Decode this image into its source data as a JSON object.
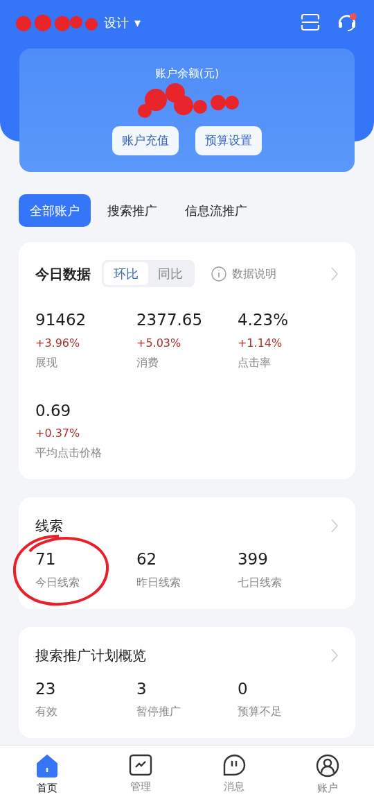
{
  "header": {
    "account_name": "设计",
    "dropdown_caret": "▾",
    "has_notification": true
  },
  "balance_card": {
    "label": "账户余额(元)",
    "buttons": [
      "账户充值",
      "预算设置"
    ]
  },
  "account_tabs": [
    {
      "label": "全部账户",
      "selected": true
    },
    {
      "label": "搜索推广",
      "selected": false
    },
    {
      "label": "信息流推广",
      "selected": false
    }
  ],
  "today_data": {
    "title": "今日数据",
    "compare_tabs": [
      {
        "label": "环比",
        "selected": true
      },
      {
        "label": "同比",
        "selected": false
      }
    ],
    "info_link": "数据说明",
    "metrics": [
      {
        "value": "91462",
        "change": "+3.96%",
        "label": "展现"
      },
      {
        "value": "2377.65",
        "change": "+5.03%",
        "label": "消费"
      },
      {
        "value": "4.23%",
        "change": "+1.14%",
        "label": "点击率"
      },
      {
        "value": "0.69",
        "change": "+0.37%",
        "label": "平均点击价格"
      }
    ]
  },
  "leads": {
    "title": "线索",
    "stats": [
      {
        "value": "71",
        "label": "今日线索",
        "circled": true
      },
      {
        "value": "62",
        "label": "昨日线索",
        "circled": false
      },
      {
        "value": "399",
        "label": "七日线索",
        "circled": false
      }
    ]
  },
  "search_plan_overview": {
    "title": "搜索推广计划概览",
    "stats": [
      {
        "value": "23",
        "label": "有效"
      },
      {
        "value": "3",
        "label": "暂停推广"
      },
      {
        "value": "0",
        "label": "预算不足"
      }
    ]
  },
  "bottom_nav": [
    {
      "label": "首页",
      "selected": true
    },
    {
      "label": "管理",
      "selected": false
    },
    {
      "label": "消息",
      "selected": false
    },
    {
      "label": "账户",
      "selected": false
    }
  ]
}
